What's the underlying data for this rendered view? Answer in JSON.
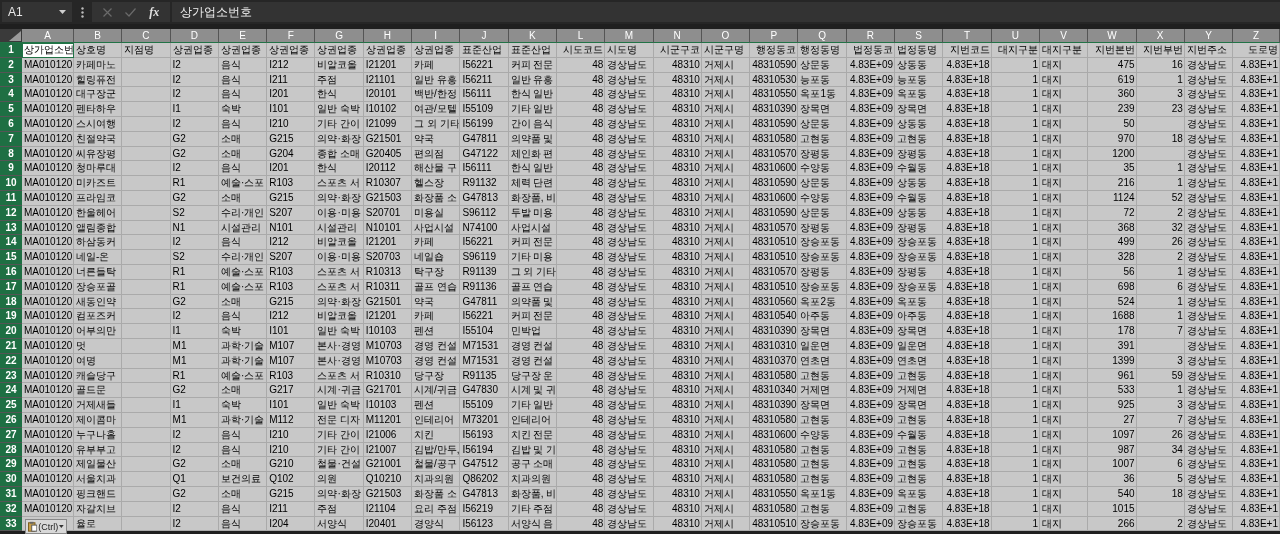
{
  "name_box": "A1",
  "formula_bar": {
    "function_label": "fx",
    "value": "상가업소번호"
  },
  "columns": [
    {
      "label": "A",
      "selected": true,
      "kind": "text"
    },
    {
      "label": "B",
      "selected": true,
      "kind": "text"
    },
    {
      "label": "C",
      "selected": true,
      "kind": "text"
    },
    {
      "label": "D",
      "selected": true,
      "kind": "text"
    },
    {
      "label": "E",
      "selected": true,
      "kind": "text"
    },
    {
      "label": "F",
      "selected": true,
      "kind": "text"
    },
    {
      "label": "G",
      "selected": true,
      "kind": "text"
    },
    {
      "label": "H",
      "selected": true,
      "kind": "text"
    },
    {
      "label": "I",
      "selected": true,
      "kind": "text"
    },
    {
      "label": "J",
      "selected": true,
      "kind": "text"
    },
    {
      "label": "K",
      "selected": true,
      "kind": "text"
    },
    {
      "label": "L",
      "selected": true,
      "kind": "number"
    },
    {
      "label": "M",
      "selected": true,
      "kind": "text"
    },
    {
      "label": "N",
      "selected": true,
      "kind": "number"
    },
    {
      "label": "O",
      "selected": true,
      "kind": "text"
    },
    {
      "label": "P",
      "selected": true,
      "kind": "number"
    },
    {
      "label": "Q",
      "selected": true,
      "kind": "text"
    },
    {
      "label": "R",
      "selected": true,
      "kind": "number"
    },
    {
      "label": "S",
      "selected": true,
      "kind": "text"
    },
    {
      "label": "T",
      "selected": true,
      "kind": "number"
    },
    {
      "label": "U",
      "selected": true,
      "kind": "number"
    },
    {
      "label": "V",
      "selected": true,
      "kind": "text"
    },
    {
      "label": "W",
      "selected": true,
      "kind": "number"
    },
    {
      "label": "X",
      "selected": true,
      "kind": "number"
    },
    {
      "label": "Y",
      "selected": true,
      "kind": "text"
    },
    {
      "label": "Z",
      "selected": true,
      "kind": "number"
    }
  ],
  "rows": [
    {
      "label": "1",
      "selected": true,
      "cells": [
        {
          "text": "상가업소번",
          "active": true
        },
        "상호명",
        "지점명",
        "상권업종",
        "상권업종",
        "상권업종",
        "상권업종",
        "상권업종",
        "상권업종",
        "표준산업",
        "표준산업",
        "시도코드",
        "시도명",
        "시군구코",
        "시군구명",
        "행정동코",
        "행정동명",
        "법정동코",
        "법정동명",
        "지번코드",
        "대지구분",
        "대지구분",
        "지번본번",
        "지번부번",
        "지번주소",
        "도로명"
      ]
    },
    {
      "label": "2",
      "selected": true,
      "cells": [
        "MA010120",
        "카페마노",
        null,
        "I2",
        "음식",
        "I212",
        "비알코올",
        "I21201",
        "카페",
        "I56221",
        "커피 전문",
        "48",
        "경상남도",
        "48310",
        "거제시",
        "48310590",
        "상문동",
        "4.83E+09",
        "상동동",
        "4.83E+18",
        "1",
        "대지",
        "475",
        "16",
        "경상남도",
        "4.83E+1"
      ]
    },
    {
      "label": "3",
      "selected": true,
      "cells": [
        "MA010120",
        "힐링퓨전",
        null,
        "I2",
        "음식",
        "I211",
        "주점",
        "I21101",
        "일반 유흥",
        "I56211",
        "일반 유흥",
        "48",
        "경상남도",
        "48310",
        "거제시",
        "48310530",
        "능포동",
        "4.83E+09",
        "능포동",
        "4.83E+18",
        "1",
        "대지",
        "619",
        "1",
        "경상남도",
        "4.83E+1"
      ]
    },
    {
      "label": "4",
      "selected": true,
      "cells": [
        "MA010120",
        "대구장군",
        null,
        "I2",
        "음식",
        "I201",
        "한식",
        "I20101",
        "백반/한정",
        "I56111",
        "한식 일반",
        "48",
        "경상남도",
        "48310",
        "거제시",
        "48310550",
        "옥포1동",
        "4.83E+09",
        "옥포동",
        "4.83E+18",
        "1",
        "대지",
        "360",
        "3",
        "경상남도",
        "4.83E+1"
      ]
    },
    {
      "label": "5",
      "selected": true,
      "cells": [
        "MA010120",
        "펜타하우",
        null,
        "I1",
        "숙박",
        "I101",
        "일반 숙박",
        "I10102",
        "여관/모텔",
        "I55109",
        "기타 일반",
        "48",
        "경상남도",
        "48310",
        "거제시",
        "48310390",
        "장목면",
        "4.83E+09",
        "장목면",
        "4.83E+18",
        "1",
        "대지",
        "239",
        "23",
        "경상남도",
        "4.83E+1"
      ]
    },
    {
      "label": "6",
      "selected": true,
      "cells": [
        "MA010120",
        "스시여행",
        null,
        "I2",
        "음식",
        "I210",
        "기타 간이",
        "I21099",
        "그 외 기타",
        "I56199",
        "간이 음식",
        "48",
        "경상남도",
        "48310",
        "거제시",
        "48310590",
        "상문동",
        "4.83E+09",
        "상동동",
        "4.83E+18",
        "1",
        "대지",
        "50",
        null,
        "경상남도",
        "4.83E+1"
      ]
    },
    {
      "label": "7",
      "selected": true,
      "cells": [
        "MA010120",
        "친절약국",
        null,
        "G2",
        "소매",
        "G215",
        "의약·화장",
        "G21501",
        "약국",
        "G47811",
        "의약품 및",
        "48",
        "경상남도",
        "48310",
        "거제시",
        "48310580",
        "고현동",
        "4.83E+09",
        "고현동",
        "4.83E+18",
        "1",
        "대지",
        "970",
        "18",
        "경상남도",
        "4.83E+1"
      ]
    },
    {
      "label": "8",
      "selected": true,
      "cells": [
        "MA010120",
        "씨유장평",
        null,
        "G2",
        "소매",
        "G204",
        "종합 소매",
        "G20405",
        "편의점",
        "G47122",
        "체인화 편",
        "48",
        "경상남도",
        "48310",
        "거제시",
        "48310570",
        "장평동",
        "4.83E+09",
        "장평동",
        "4.83E+18",
        "1",
        "대지",
        "1200",
        null,
        "경상남도",
        "4.83E+1"
      ]
    },
    {
      "label": "9",
      "selected": true,
      "cells": [
        "MA010120",
        "청마루대",
        null,
        "I2",
        "음식",
        "I201",
        "한식",
        "I20112",
        "해산물 구",
        "I56111",
        "한식 일반",
        "48",
        "경상남도",
        "48310",
        "거제시",
        "48310600",
        "수양동",
        "4.83E+09",
        "수월동",
        "4.83E+18",
        "1",
        "대지",
        "35",
        "1",
        "경상남도",
        "4.83E+1"
      ]
    },
    {
      "label": "10",
      "selected": true,
      "cells": [
        "MA010120",
        "미카즈트",
        null,
        "R1",
        "예술·스포",
        "R103",
        "스포츠 서",
        "R10307",
        "헬스장",
        "R91132",
        "체력 단련",
        "48",
        "경상남도",
        "48310",
        "거제시",
        "48310590",
        "상문동",
        "4.83E+09",
        "상동동",
        "4.83E+18",
        "1",
        "대지",
        "216",
        "1",
        "경상남도",
        "4.83E+1"
      ]
    },
    {
      "label": "11",
      "selected": true,
      "cells": [
        "MA010120",
        "프라임코",
        null,
        "G2",
        "소매",
        "G215",
        "의약·화장",
        "G21503",
        "화장품 소",
        "G47813",
        "화장품, 비",
        "48",
        "경상남도",
        "48310",
        "거제시",
        "48310600",
        "수양동",
        "4.83E+09",
        "수월동",
        "4.83E+18",
        "1",
        "대지",
        "1124",
        "52",
        "경상남도",
        "4.83E+1"
      ]
    },
    {
      "label": "12",
      "selected": true,
      "cells": [
        "MA010120",
        "한울헤어",
        null,
        "S2",
        "수리·개인",
        "S207",
        "이용·미용",
        "S20701",
        "미용실",
        "S96112",
        "두발 미용",
        "48",
        "경상남도",
        "48310",
        "거제시",
        "48310590",
        "상문동",
        "4.83E+09",
        "상동동",
        "4.83E+18",
        "1",
        "대지",
        "72",
        "2",
        "경상남도",
        "4.83E+1"
      ]
    },
    {
      "label": "13",
      "selected": true,
      "cells": [
        "MA010120",
        "앨림종합",
        null,
        "N1",
        "시설관리",
        "N101",
        "시설관리",
        "N10101",
        "사업시설",
        "N74100",
        "사업시설",
        "48",
        "경상남도",
        "48310",
        "거제시",
        "48310570",
        "장평동",
        "4.83E+09",
        "장평동",
        "4.83E+18",
        "1",
        "대지",
        "368",
        "32",
        "경상남도",
        "4.83E+1"
      ]
    },
    {
      "label": "14",
      "selected": true,
      "cells": [
        "MA010120",
        "하삼동커",
        null,
        "I2",
        "음식",
        "I212",
        "비알코올",
        "I21201",
        "카페",
        "I56221",
        "커피 전문",
        "48",
        "경상남도",
        "48310",
        "거제시",
        "48310510",
        "장승포동",
        "4.83E+09",
        "장승포동",
        "4.83E+18",
        "1",
        "대지",
        "499",
        "26",
        "경상남도",
        "4.83E+1"
      ]
    },
    {
      "label": "15",
      "selected": true,
      "cells": [
        "MA010120",
        "네일-온",
        null,
        "S2",
        "수리·개인",
        "S207",
        "이용·미용",
        "S20703",
        "네일숍",
        "S96119",
        "기타 미용",
        "48",
        "경상남도",
        "48310",
        "거제시",
        "48310510",
        "장승포동",
        "4.83E+09",
        "장승포동",
        "4.83E+18",
        "1",
        "대지",
        "328",
        "2",
        "경상남도",
        "4.83E+1"
      ]
    },
    {
      "label": "16",
      "selected": true,
      "cells": [
        "MA010120",
        "너른들탁",
        null,
        "R1",
        "예술·스포",
        "R103",
        "스포츠 서",
        "R10313",
        "탁구장",
        "R91139",
        "그 외 기타",
        "48",
        "경상남도",
        "48310",
        "거제시",
        "48310570",
        "장평동",
        "4.83E+09",
        "장평동",
        "4.83E+18",
        "1",
        "대지",
        "56",
        "1",
        "경상남도",
        "4.83E+1"
      ]
    },
    {
      "label": "17",
      "selected": true,
      "cells": [
        "MA010120",
        "장승포골",
        null,
        "R1",
        "예술·스포",
        "R103",
        "스포츠 서",
        "R10311",
        "골프 연습",
        "R91136",
        "골프 연습",
        "48",
        "경상남도",
        "48310",
        "거제시",
        "48310510",
        "장승포동",
        "4.83E+09",
        "장승포동",
        "4.83E+18",
        "1",
        "대지",
        "698",
        "6",
        "경상남도",
        "4.83E+1"
      ]
    },
    {
      "label": "18",
      "selected": true,
      "cells": [
        "MA010120",
        "새동인약",
        null,
        "G2",
        "소매",
        "G215",
        "의약·화장",
        "G21501",
        "약국",
        "G47811",
        "의약품 및",
        "48",
        "경상남도",
        "48310",
        "거제시",
        "48310560",
        "옥포2동",
        "4.83E+09",
        "옥포동",
        "4.83E+18",
        "1",
        "대지",
        "524",
        "1",
        "경상남도",
        "4.83E+1"
      ]
    },
    {
      "label": "19",
      "selected": true,
      "cells": [
        "MA010120",
        "컴포즈커",
        null,
        "I2",
        "음식",
        "I212",
        "비알코올",
        "I21201",
        "카페",
        "I56221",
        "커피 전문",
        "48",
        "경상남도",
        "48310",
        "거제시",
        "48310540",
        "아주동",
        "4.83E+09",
        "아주동",
        "4.83E+18",
        "1",
        "대지",
        "1688",
        "1",
        "경상남도",
        "4.83E+1"
      ]
    },
    {
      "label": "20",
      "selected": true,
      "cells": [
        "MA010120",
        "어부의만",
        null,
        "I1",
        "숙박",
        "I101",
        "일반 숙박",
        "I10103",
        "펜션",
        "I55104",
        "민박업",
        "48",
        "경상남도",
        "48310",
        "거제시",
        "48310390",
        "장목면",
        "4.83E+09",
        "장목면",
        "4.83E+18",
        "1",
        "대지",
        "178",
        "7",
        "경상남도",
        "4.83E+1"
      ]
    },
    {
      "label": "21",
      "selected": true,
      "cells": [
        "MA010120",
        "멋",
        null,
        "M1",
        "과학·기술",
        "M107",
        "본사·경영",
        "M10703",
        "경영 컨설",
        "M71531",
        "경영 컨설",
        "48",
        "경상남도",
        "48310",
        "거제시",
        "48310310",
        "일운면",
        "4.83E+09",
        "일운면",
        "4.83E+18",
        "1",
        "대지",
        "391",
        null,
        "경상남도",
        "4.83E+1"
      ]
    },
    {
      "label": "22",
      "selected": true,
      "cells": [
        "MA010120",
        "여명",
        null,
        "M1",
        "과학·기술",
        "M107",
        "본사·경영",
        "M10703",
        "경영 컨설",
        "M71531",
        "경영 컨설",
        "48",
        "경상남도",
        "48310",
        "거제시",
        "48310370",
        "연초면",
        "4.83E+09",
        "연초면",
        "4.83E+18",
        "1",
        "대지",
        "1399",
        "3",
        "경상남도",
        "4.83E+1"
      ]
    },
    {
      "label": "23",
      "selected": true,
      "cells": [
        "MA010120",
        "캐슬당구",
        null,
        "R1",
        "예술·스포",
        "R103",
        "스포츠 서",
        "R10310",
        "당구장",
        "R91135",
        "당구장 운",
        "48",
        "경상남도",
        "48310",
        "거제시",
        "48310580",
        "고현동",
        "4.83E+09",
        "고현동",
        "4.83E+18",
        "1",
        "대지",
        "961",
        "59",
        "경상남도",
        "4.83E+1"
      ]
    },
    {
      "label": "24",
      "selected": true,
      "cells": [
        "MA010120",
        "골드문",
        null,
        "G2",
        "소매",
        "G217",
        "시계·귀금",
        "G21701",
        "시계/귀금",
        "G47830",
        "시계 및 귀",
        "48",
        "경상남도",
        "48310",
        "거제시",
        "48310340",
        "거제면",
        "4.83E+09",
        "거제면",
        "4.83E+18",
        "1",
        "대지",
        "533",
        "1",
        "경상남도",
        "4.83E+1"
      ]
    },
    {
      "label": "25",
      "selected": true,
      "cells": [
        "MA010120",
        "거제새들",
        null,
        "I1",
        "숙박",
        "I101",
        "일반 숙박",
        "I10103",
        "펜션",
        "I55109",
        "기타 일반",
        "48",
        "경상남도",
        "48310",
        "거제시",
        "48310390",
        "장목면",
        "4.83E+09",
        "장목면",
        "4.83E+18",
        "1",
        "대지",
        "925",
        "3",
        "경상남도",
        "4.83E+1"
      ]
    },
    {
      "label": "26",
      "selected": true,
      "cells": [
        "MA010120",
        "제이콤마",
        null,
        "M1",
        "과학·기술",
        "M112",
        "전문 디자",
        "M11201",
        "인테리어",
        "M73201",
        "인테리어",
        "48",
        "경상남도",
        "48310",
        "거제시",
        "48310580",
        "고현동",
        "4.83E+09",
        "고현동",
        "4.83E+18",
        "1",
        "대지",
        "27",
        "7",
        "경상남도",
        "4.83E+1"
      ]
    },
    {
      "label": "27",
      "selected": true,
      "cells": [
        "MA010120",
        "누구나홀",
        null,
        "I2",
        "음식",
        "I210",
        "기타 간이",
        "I21006",
        "치킨",
        "I56193",
        "치킨 전문",
        "48",
        "경상남도",
        "48310",
        "거제시",
        "48310600",
        "수양동",
        "4.83E+09",
        "수월동",
        "4.83E+18",
        "1",
        "대지",
        "1097",
        "26",
        "경상남도",
        "4.83E+1"
      ]
    },
    {
      "label": "28",
      "selected": true,
      "cells": [
        "MA010120",
        "유부부고",
        null,
        "I2",
        "음식",
        "I210",
        "기타 간이",
        "I21007",
        "김밥/만두,",
        "I56194",
        "김밥 및 기",
        "48",
        "경상남도",
        "48310",
        "거제시",
        "48310580",
        "고현동",
        "4.83E+09",
        "고현동",
        "4.83E+18",
        "1",
        "대지",
        "987",
        "34",
        "경상남도",
        "4.83E+1"
      ]
    },
    {
      "label": "29",
      "selected": true,
      "cells": [
        "MA010120",
        "제일물산",
        null,
        "G2",
        "소매",
        "G210",
        "철물·건설",
        "G21001",
        "철물/공구",
        "G47512",
        "공구 소매",
        "48",
        "경상남도",
        "48310",
        "거제시",
        "48310580",
        "고현동",
        "4.83E+09",
        "고현동",
        "4.83E+18",
        "1",
        "대지",
        "1007",
        "6",
        "경상남도",
        "4.83E+1"
      ]
    },
    {
      "label": "30",
      "selected": true,
      "cells": [
        "MA010120",
        "서울치과",
        null,
        "Q1",
        "보건의료",
        "Q102",
        "의원",
        "Q10210",
        "치과의원",
        "Q86202",
        "치과의원",
        "48",
        "경상남도",
        "48310",
        "거제시",
        "48310580",
        "고현동",
        "4.83E+09",
        "고현동",
        "4.83E+18",
        "1",
        "대지",
        "36",
        "5",
        "경상남도",
        "4.83E+1"
      ]
    },
    {
      "label": "31",
      "selected": true,
      "cells": [
        "MA010120",
        "핑크핸드",
        null,
        "G2",
        "소매",
        "G215",
        "의약·화장",
        "G21503",
        "화장품 소",
        "G47813",
        "화장품, 비",
        "48",
        "경상남도",
        "48310",
        "거제시",
        "48310550",
        "옥포1동",
        "4.83E+09",
        "옥포동",
        "4.83E+18",
        "1",
        "대지",
        "540",
        "18",
        "경상남도",
        "4.83E+1"
      ]
    },
    {
      "label": "32",
      "selected": true,
      "cells": [
        "MA010120",
        "자갈치브",
        null,
        "I2",
        "음식",
        "I211",
        "주점",
        "I21104",
        "요리 주점",
        "I56219",
        "기타 주점",
        "48",
        "경상남도",
        "48310",
        "거제시",
        "48310580",
        "고현동",
        "4.83E+09",
        "고현동",
        "4.83E+18",
        "1",
        "대지",
        "1015",
        null,
        "경상남도",
        "4.83E+1"
      ]
    },
    {
      "label": "33",
      "selected": true,
      "cells": [
        null,
        "율로",
        null,
        "I2",
        "음식",
        "I204",
        "서양식",
        "I20401",
        "경양식",
        "I56123",
        "서양식 음",
        "48",
        "경상남도",
        "48310",
        "거제시",
        "48310510",
        "장승포동",
        "4.83E+09",
        "장승포동",
        "4.83E+18",
        "1",
        "대지",
        "266",
        "2",
        "경상남도",
        "4.83E+1"
      ]
    }
  ],
  "paste_options": {
    "label": "(Ctrl)"
  }
}
